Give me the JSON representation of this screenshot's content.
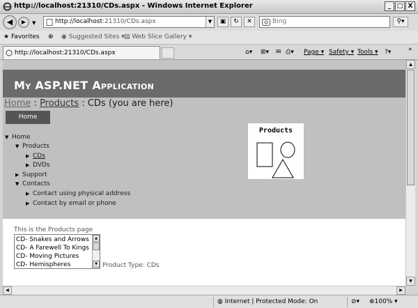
{
  "window": {
    "title": "http://localhost:21310/CDs.aspx - Windows Internet Explorer",
    "minimize": "_",
    "maximize": "□",
    "close": "X"
  },
  "address": {
    "url_host": "http://localhost",
    "url_rest": ":21310/CDs.aspx",
    "search_placeholder": "Bing"
  },
  "favorites_bar": {
    "favorites": "Favorites",
    "suggested": "Suggested Sites ▾",
    "webslice": "Web Slice Gallery ▾"
  },
  "tab": {
    "label": "http://localhost:21310/CDs.aspx"
  },
  "command_bar": {
    "page": "Page ▾",
    "safety": "Safety ▾",
    "tools": "Tools ▾",
    "help": "?▾"
  },
  "page": {
    "app_title": "My ASP.NET Application",
    "breadcrumb": {
      "home": "Home",
      "sep1": " : ",
      "products": "Products",
      "sep2": " : ",
      "current": "CDs (you are here)"
    },
    "menu_home": "Home",
    "tree": [
      {
        "label": "Home",
        "arrow": "▼"
      },
      {
        "label": "Products",
        "arrow": "▼"
      },
      {
        "label": "CDs",
        "arrow": "▶"
      },
      {
        "label": "DVDs",
        "arrow": "▶"
      },
      {
        "label": "Support",
        "arrow": "▶"
      },
      {
        "label": "Contacts",
        "arrow": "▼"
      },
      {
        "label": "Contact using physical address",
        "arrow": "▶"
      },
      {
        "label": "Contact by email or phone",
        "arrow": "▶"
      }
    ],
    "products_image_caption": "Products",
    "products_page_label": "This is the Products page",
    "cd_list": [
      "CD- Snakes and Arrows",
      "CD- A Farewell To Kings",
      "CD- Moving Pictures",
      "CD- Hemispheres"
    ],
    "product_type": "Product Type: CDs"
  },
  "status": {
    "zone": "Internet | Protected Mode: On",
    "zoom": "100%"
  }
}
